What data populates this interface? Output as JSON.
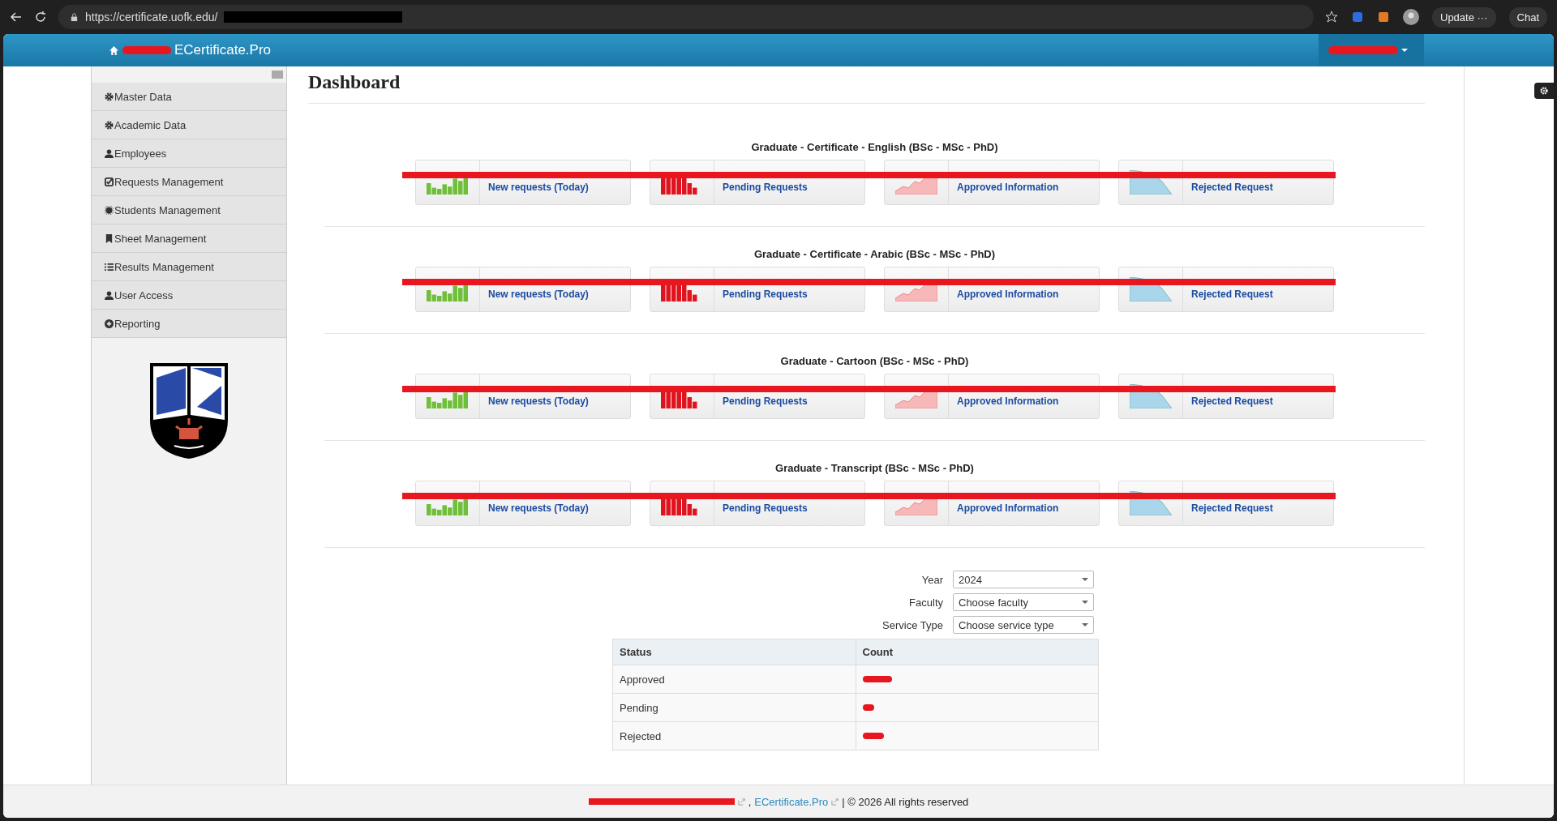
{
  "browser": {
    "url": "https://certificate.uofk.edu/",
    "update_label": "Update ···",
    "chat_label": "Chat"
  },
  "header": {
    "brand": "ECertificate.Pro"
  },
  "sidebar": {
    "items": [
      {
        "label": "Master Data",
        "kind": "cog"
      },
      {
        "label": "Academic Data",
        "kind": "cog"
      },
      {
        "label": "Employees",
        "kind": "user"
      },
      {
        "label": "Requests Management",
        "kind": "check"
      },
      {
        "label": "Students Management",
        "kind": "star"
      },
      {
        "label": "Sheet Management",
        "kind": "bookmark"
      },
      {
        "label": "Results Management",
        "kind": "list"
      },
      {
        "label": "User Access",
        "kind": "user"
      },
      {
        "label": "Reporting",
        "kind": "plus"
      }
    ]
  },
  "page": {
    "title": "Dashboard"
  },
  "sections": [
    {
      "title": "Graduate - Certificate - English (BSc - MSc - PhD)",
      "cards": [
        {
          "kind": "new",
          "label": "New requests (Today)"
        },
        {
          "kind": "pending",
          "label": "Pending Requests"
        },
        {
          "kind": "approved",
          "label": "Approved Information"
        },
        {
          "kind": "rejected",
          "label": "Rejected Request"
        }
      ]
    },
    {
      "title": "Graduate - Certificate - Arabic (BSc - MSc - PhD)",
      "cards": [
        {
          "kind": "new",
          "label": "New requests (Today)"
        },
        {
          "kind": "pending",
          "label": "Pending Requests"
        },
        {
          "kind": "approved",
          "label": "Approved Information"
        },
        {
          "kind": "rejected",
          "label": "Rejected Request"
        }
      ]
    },
    {
      "title": "Graduate - Cartoon (BSc - MSc - PhD)",
      "cards": [
        {
          "kind": "new",
          "label": "New requests (Today)"
        },
        {
          "kind": "pending",
          "label": "Pending Requests"
        },
        {
          "kind": "approved",
          "label": "Approved Information"
        },
        {
          "kind": "rejected",
          "label": "Rejected Request"
        }
      ]
    },
    {
      "title": "Graduate - Transcript (BSc - MSc - PhD)",
      "cards": [
        {
          "kind": "new",
          "label": "New requests (Today)"
        },
        {
          "kind": "pending",
          "label": "Pending Requests"
        },
        {
          "kind": "approved",
          "label": "Approved Information"
        },
        {
          "kind": "rejected",
          "label": "Rejected Request"
        }
      ]
    }
  ],
  "filters": [
    {
      "label": "Year",
      "value": "2024"
    },
    {
      "label": "Faculty",
      "value": "Choose faculty"
    },
    {
      "label": "Service Type",
      "value": "Choose service type"
    }
  ],
  "table": {
    "columns": [
      "Status",
      "Count"
    ],
    "rows": [
      {
        "status": "Approved"
      },
      {
        "status": "Pending"
      },
      {
        "status": "Rejected"
      }
    ]
  },
  "footer": {
    "separator": ",",
    "link": "ECertificate.Pro",
    "text": "| © 2026 All rights reserved"
  }
}
